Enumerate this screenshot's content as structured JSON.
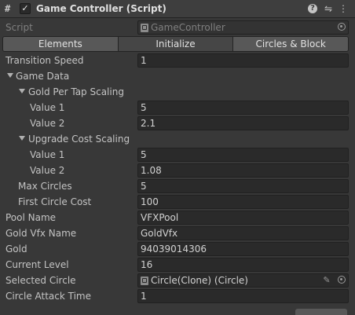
{
  "header": {
    "hash_icon": "#",
    "checkbox_mark": "✓",
    "title": "Game Controller (Script)",
    "help_icon": "?",
    "preset_icon": "⇋",
    "menu_icon": "⋮"
  },
  "script_field": {
    "label": "Script",
    "value": "GameController"
  },
  "tabs": [
    {
      "label": "Elements"
    },
    {
      "label": "Initialize"
    },
    {
      "label": "Circles & Block"
    }
  ],
  "active_tab": "Initialize",
  "fields": {
    "transition_speed": {
      "label": "Transition Speed",
      "value": "1"
    },
    "game_data": {
      "label": "Game Data"
    },
    "gold_per_tap": {
      "label": "Gold Per Tap Scaling"
    },
    "gpt_value1": {
      "label": "Value 1",
      "value": "5"
    },
    "gpt_value2": {
      "label": "Value 2",
      "value": "2.1"
    },
    "upgrade_cost": {
      "label": "Upgrade Cost Scaling"
    },
    "uc_value1": {
      "label": "Value 1",
      "value": "5"
    },
    "uc_value2": {
      "label": "Value 2",
      "value": "1.08"
    },
    "max_circles": {
      "label": "Max Circles",
      "value": "5"
    },
    "first_circle_cost": {
      "label": "First Circle Cost",
      "value": "100"
    },
    "pool_name": {
      "label": "Pool Name",
      "value": "VFXPool"
    },
    "gold_vfx_name": {
      "label": "Gold Vfx Name",
      "value": "GoldVfx"
    },
    "gold": {
      "label": "Gold",
      "value": "94039014306"
    },
    "current_level": {
      "label": "Current Level",
      "value": "16"
    },
    "selected_circle": {
      "label": "Selected Circle",
      "value": "Circle(Clone) (Circle)"
    },
    "circle_attack_time": {
      "label": "Circle Attack Time",
      "value": "1"
    }
  }
}
